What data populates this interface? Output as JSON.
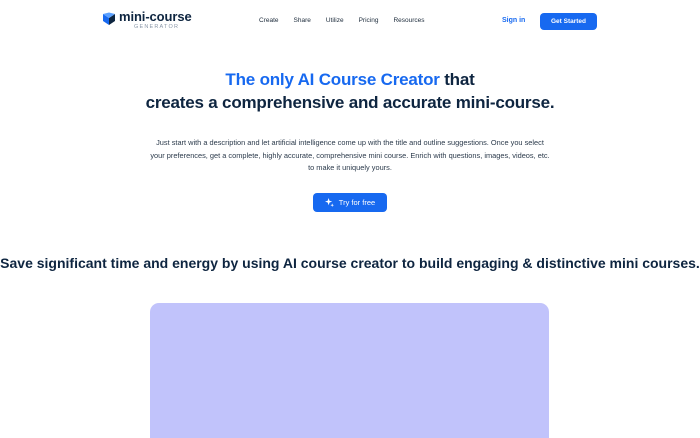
{
  "nav": {
    "logo_name": "mini-course",
    "logo_sub": "GENERATOR",
    "menu": [
      "Create",
      "Share",
      "Utilize",
      "Pricing",
      "Resources"
    ],
    "signin": "Sign in",
    "get_started": "Get Started"
  },
  "hero": {
    "title_accent": "The only AI Course Creator",
    "title_rest": " that",
    "title_line2": "creates a comprehensive and accurate mini-course.",
    "description": "Just start with a description and let artificial intelligence come up with the title and outline suggestions. Once you select your preferences, get a complete, highly accurate, comprehensive mini course. Enrich with questions, images, videos, etc. to make it uniquely yours.",
    "cta_icon": "sparkle-icon",
    "cta_label": "Try for free"
  },
  "section": {
    "title": "Save significant time and energy by using AI course creator to build engaging & distinctive mini courses."
  },
  "colors": {
    "accent": "#1769f0",
    "heading": "#0e2540",
    "panel": "#c1c3fb"
  }
}
